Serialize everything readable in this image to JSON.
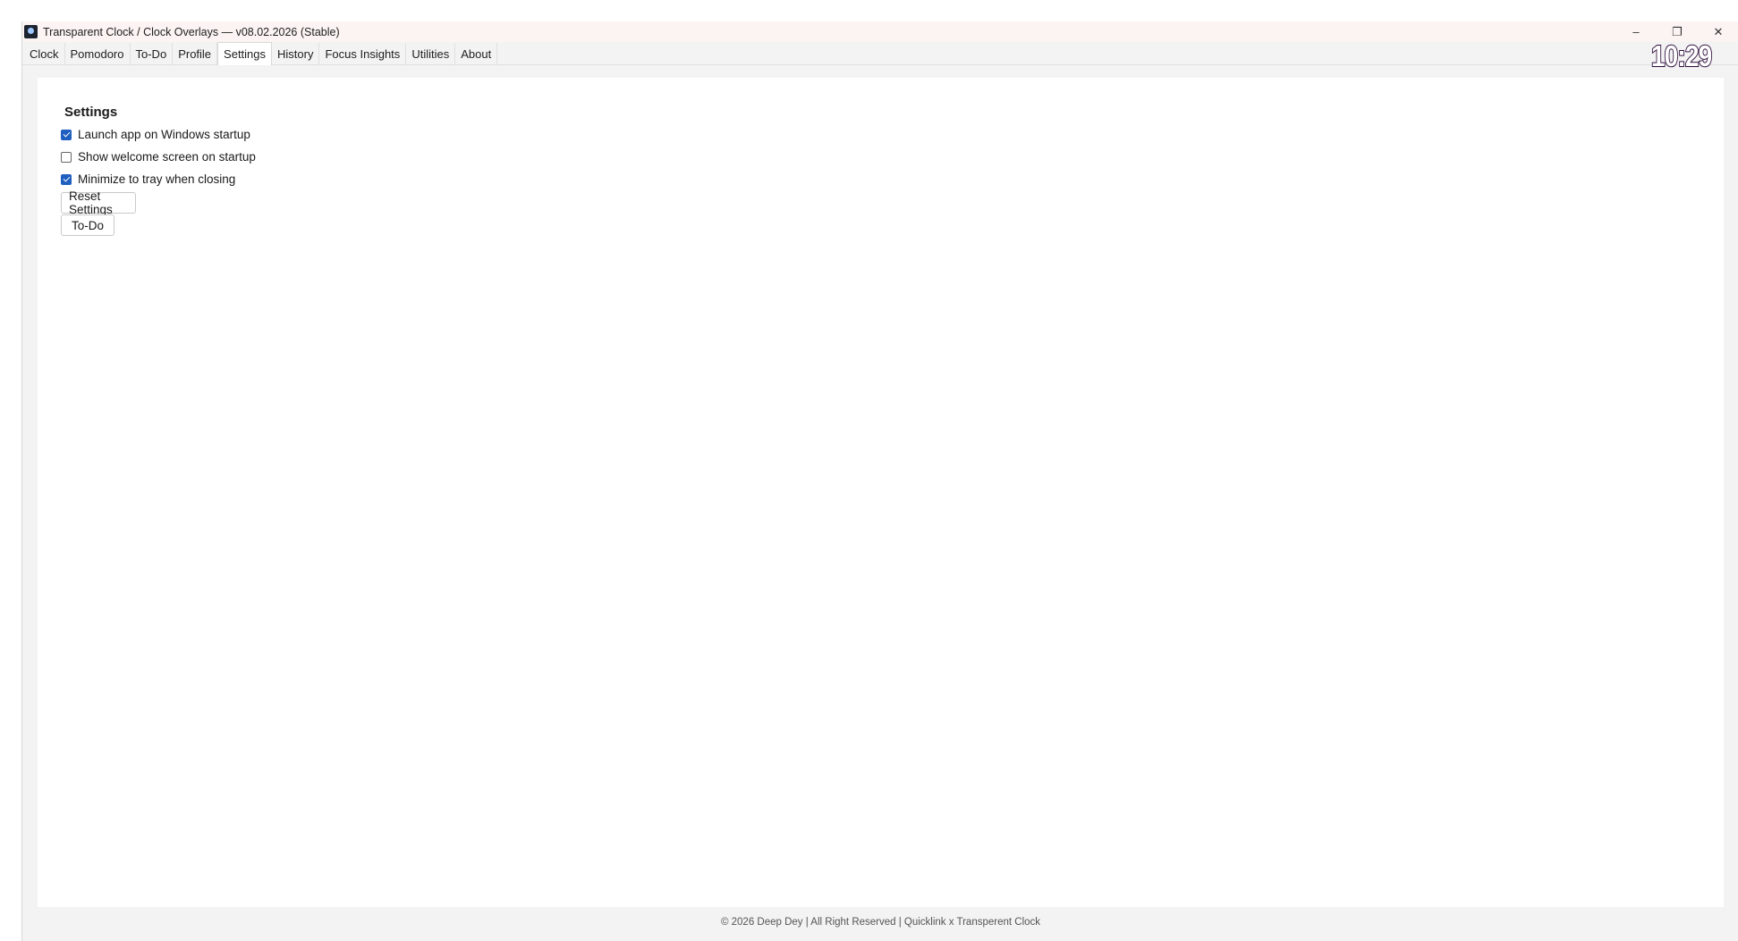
{
  "window": {
    "title": "Transparent Clock / Clock Overlays — v08.02.2026 (Stable)",
    "controls": {
      "minimize": "–",
      "restore": "❐",
      "close": "✕"
    }
  },
  "tabs": [
    "Clock",
    "Pomodoro",
    "To-Do",
    "Profile",
    "Settings",
    "History",
    "Focus Insights",
    "Utilities",
    "About"
  ],
  "active_tab": "Settings",
  "clock_overlay": "10:29",
  "settings": {
    "title": "Settings",
    "options": [
      {
        "label": "Launch app on Windows startup",
        "checked": true
      },
      {
        "label": "Show welcome screen on startup",
        "checked": false
      },
      {
        "label": "Minimize to tray when closing",
        "checked": true
      }
    ],
    "reset_button": "Reset Settings",
    "todo_button": "To-Do"
  },
  "footer": "© 2026 Deep Dey | All Right Reserved | Quicklink x Transperent Clock",
  "colors": {
    "accent": "#1f5fbf",
    "titlebar": "#fbf4f2",
    "window_bg": "#f3f3f3"
  }
}
